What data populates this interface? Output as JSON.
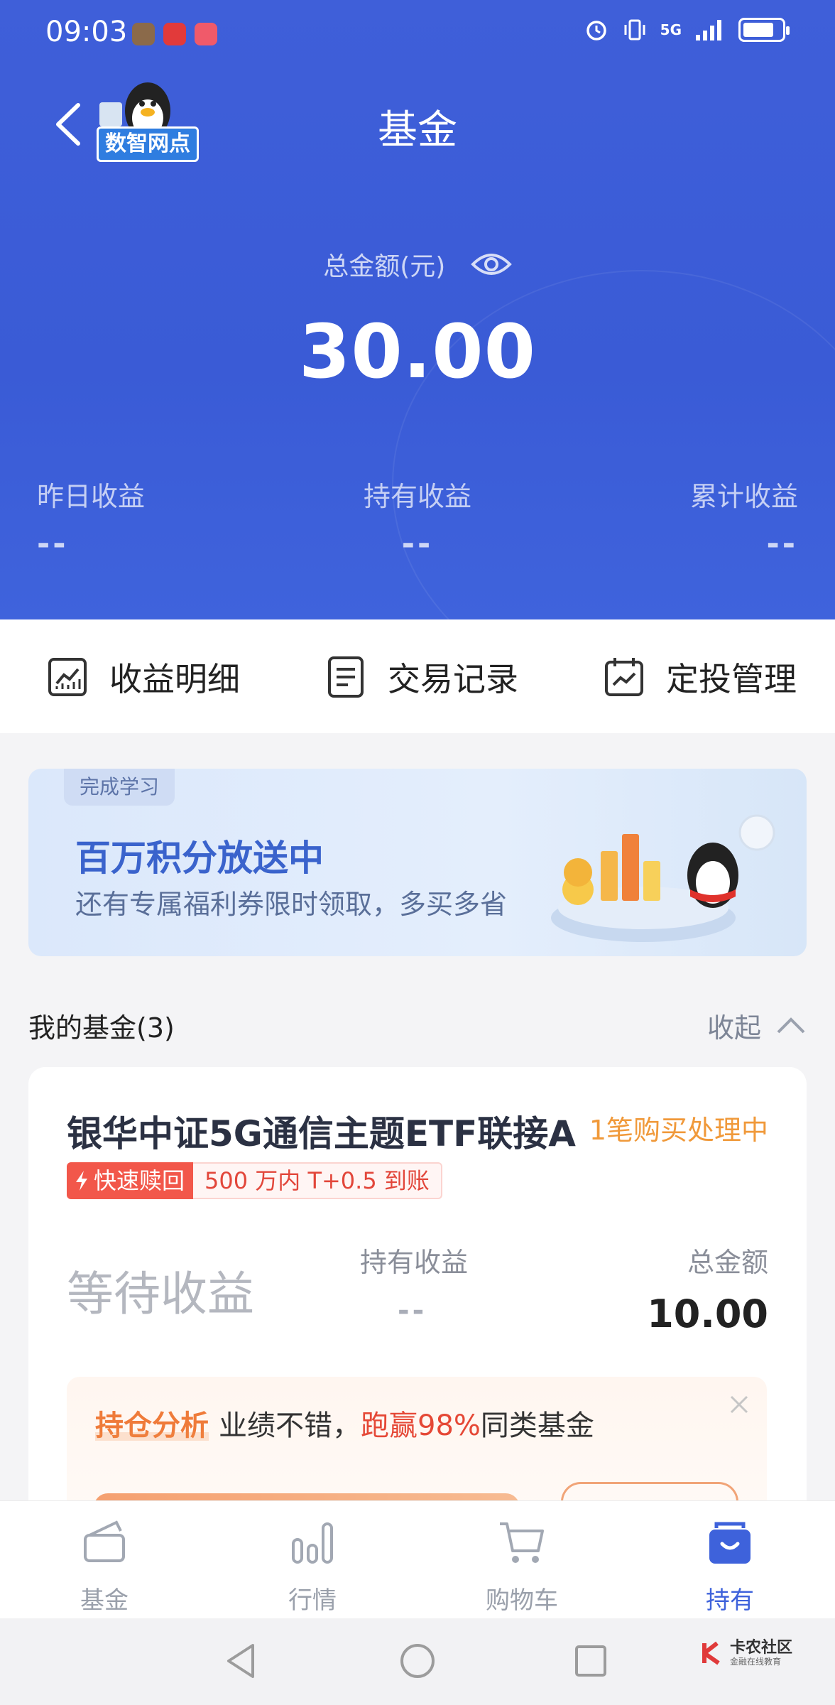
{
  "status_bar": {
    "time": "09:03",
    "network": "5G"
  },
  "header": {
    "title": "基金",
    "badge": "数智网点"
  },
  "summary": {
    "total_label": "总金额(元)",
    "total_value": "30.00",
    "stats": [
      {
        "label": "昨日收益",
        "value": "--"
      },
      {
        "label": "持有收益",
        "value": "--"
      },
      {
        "label": "累计收益",
        "value": "--"
      }
    ]
  },
  "actions": [
    {
      "label": "收益明细",
      "icon": "chart-icon"
    },
    {
      "label": "交易记录",
      "icon": "document-icon"
    },
    {
      "label": "定投管理",
      "icon": "calendar-icon"
    }
  ],
  "banner": {
    "tag": "完成学习",
    "title": "百万积分放送中",
    "subtitle": "还有专属福利券限时领取，多买多省"
  },
  "my_funds": {
    "title": "我的基金(3)",
    "collapse_label": "收起"
  },
  "fund_card": {
    "name": "银华中证5G通信主题ETF联接A",
    "status": "1笔购买处理中",
    "tag_fast": "快速赎回",
    "tag_detail": "500 万内 T+0.5 到账",
    "await_label": "等待收益",
    "hold_label": "持有收益",
    "hold_value": "--",
    "amount_label": "总金额",
    "amount_value": "10.00",
    "analysis": {
      "title": "持仓分析",
      "text_pre": "业绩不错，",
      "text_highlight": "跑赢98%",
      "text_post": "同类基金"
    }
  },
  "tabbar": [
    {
      "label": "基金",
      "icon": "fund-icon",
      "active": false
    },
    {
      "label": "行情",
      "icon": "bar-chart-icon",
      "active": false
    },
    {
      "label": "购物车",
      "icon": "cart-icon",
      "active": false
    },
    {
      "label": "持有",
      "icon": "bag-icon",
      "active": true
    }
  ],
  "watermark": {
    "main": "卡农社区",
    "sub": "金融在线教育"
  },
  "colors": {
    "primary": "#3e62db",
    "orange": "#f0993a",
    "red": "#e54836"
  }
}
